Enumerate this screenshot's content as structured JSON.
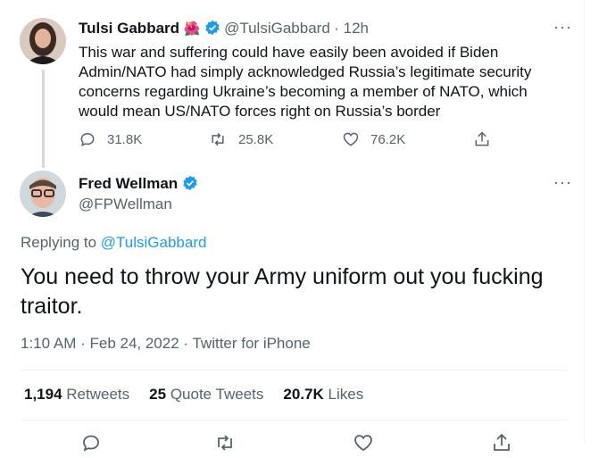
{
  "original_tweet": {
    "author_name": "Tulsi Gabbard",
    "author_emoji": "🌺",
    "handle": "@TulsiGabbard",
    "time": "· 12h",
    "text": "This war and suffering could have easily been avoided if Biden Admin/NATO had simply acknowledged Russia’s legitimate security concerns regarding Ukraine’s becoming a member of NATO, which would mean US/NATO forces right on Russia’s border",
    "replies": "31.8K",
    "retweets": "25.8K",
    "likes": "76.2K"
  },
  "reply_tweet": {
    "author_name": "Fred Wellman",
    "handle": "@FPWellman",
    "replying_prefix": "Replying to ",
    "replying_handle": "@TulsiGabbard",
    "text": "You need to throw your Army uniform out you fucking traitor.",
    "timestamp": "1:10 AM · Feb 24, 2022 · Twitter for iPhone",
    "retweets_count": "1,194",
    "retweets_label": "Retweets",
    "quotes_count": "25",
    "quotes_label": "Quote Tweets",
    "likes_count": "20.7K",
    "likes_label": "Likes"
  },
  "more_label": "···",
  "colors": {
    "accent": "#1d9bf0",
    "secondary_text": "#536471",
    "divider": "#eff3f4"
  }
}
